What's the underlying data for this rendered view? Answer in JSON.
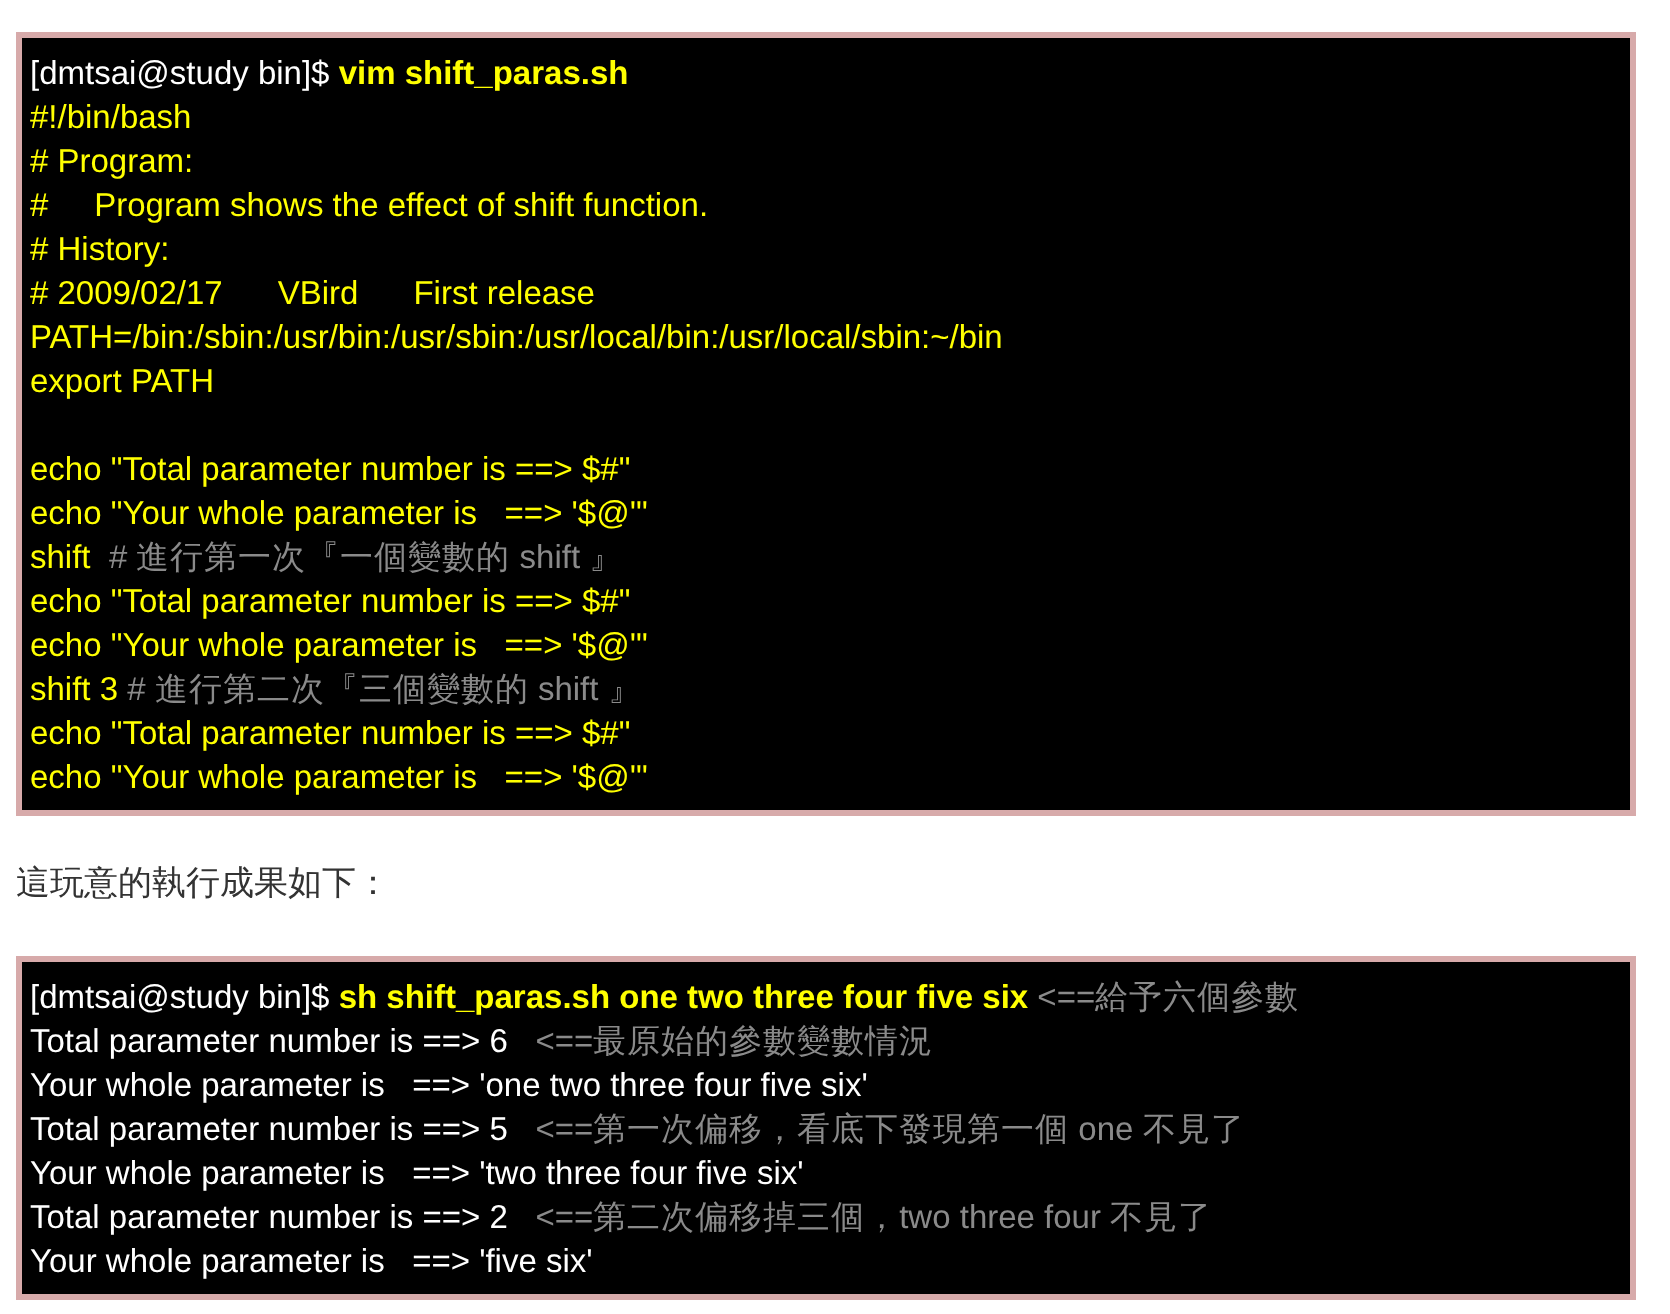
{
  "script_listing": {
    "lines": [
      {
        "kind": "text",
        "segments": [
          {
            "kind": "prompt",
            "text": "[dmtsai@study bin]$ "
          },
          {
            "kind": "command",
            "text": "vim shift_paras.sh"
          }
        ]
      },
      {
        "kind": "text",
        "segments": [
          {
            "kind": "code",
            "text": "#!/bin/bash"
          }
        ]
      },
      {
        "kind": "text",
        "segments": [
          {
            "kind": "code",
            "text": "# Program:"
          }
        ]
      },
      {
        "kind": "text",
        "segments": [
          {
            "kind": "code",
            "text": "#     Program shows the effect of shift function."
          }
        ]
      },
      {
        "kind": "text",
        "segments": [
          {
            "kind": "code",
            "text": "# History:"
          }
        ]
      },
      {
        "kind": "text",
        "segments": [
          {
            "kind": "code",
            "text": "# 2009/02/17      VBird      First release"
          }
        ]
      },
      {
        "kind": "text",
        "segments": [
          {
            "kind": "code",
            "text": "PATH=/bin:/sbin:/usr/bin:/usr/sbin:/usr/local/bin:/usr/local/sbin:~/bin"
          }
        ]
      },
      {
        "kind": "text",
        "segments": [
          {
            "kind": "code",
            "text": "export PATH"
          }
        ]
      },
      {
        "kind": "blank"
      },
      {
        "kind": "text",
        "segments": [
          {
            "kind": "code",
            "text": "echo \"Total parameter number is ==> $#\""
          }
        ]
      },
      {
        "kind": "text",
        "segments": [
          {
            "kind": "code",
            "text": "echo \"Your whole parameter is   ==> '$@'\""
          }
        ]
      },
      {
        "kind": "text",
        "segments": [
          {
            "kind": "code",
            "text": "shift  "
          },
          {
            "kind": "comment",
            "text": "# 進行第一次『一個變數的 shift 』"
          }
        ]
      },
      {
        "kind": "text",
        "segments": [
          {
            "kind": "code",
            "text": "echo \"Total parameter number is ==> $#\""
          }
        ]
      },
      {
        "kind": "text",
        "segments": [
          {
            "kind": "code",
            "text": "echo \"Your whole parameter is   ==> '$@'\""
          }
        ]
      },
      {
        "kind": "text",
        "segments": [
          {
            "kind": "code",
            "text": "shift 3 "
          },
          {
            "kind": "comment",
            "text": "# 進行第二次『三個變數的 shift 』"
          }
        ]
      },
      {
        "kind": "text",
        "segments": [
          {
            "kind": "code",
            "text": "echo \"Total parameter number is ==> $#\""
          }
        ]
      },
      {
        "kind": "text",
        "segments": [
          {
            "kind": "code",
            "text": "echo \"Your whole parameter is   ==> '$@'\""
          }
        ]
      }
    ]
  },
  "result_intro": "這玩意的執行成果如下：",
  "run_output": {
    "lines": [
      {
        "kind": "text",
        "segments": [
          {
            "kind": "prompt",
            "text": "[dmtsai@study bin]$ "
          },
          {
            "kind": "command",
            "text": "sh shift_paras.sh one two three four five six"
          },
          {
            "kind": "comment",
            "text": " <==給予六個參數"
          }
        ]
      },
      {
        "kind": "text",
        "segments": [
          {
            "kind": "output",
            "text": "Total parameter number is ==> 6   "
          },
          {
            "kind": "comment",
            "text": "<==最原始的參數變數情況"
          }
        ]
      },
      {
        "kind": "text",
        "segments": [
          {
            "kind": "output",
            "text": "Your whole parameter is   ==> 'one two three four five six'"
          }
        ]
      },
      {
        "kind": "text",
        "segments": [
          {
            "kind": "output",
            "text": "Total parameter number is ==> 5   "
          },
          {
            "kind": "comment",
            "text": "<==第一次偏移，看底下發現第一個 one 不見了"
          }
        ]
      },
      {
        "kind": "text",
        "segments": [
          {
            "kind": "output",
            "text": "Your whole parameter is   ==> 'two three four five six'"
          }
        ]
      },
      {
        "kind": "text",
        "segments": [
          {
            "kind": "output",
            "text": "Total parameter number is ==> 2   "
          },
          {
            "kind": "comment",
            "text": "<==第二次偏移掉三個，two three four 不見了"
          }
        ]
      },
      {
        "kind": "text",
        "segments": [
          {
            "kind": "output",
            "text": "Your whole parameter is   ==> 'five six'"
          }
        ]
      }
    ]
  }
}
